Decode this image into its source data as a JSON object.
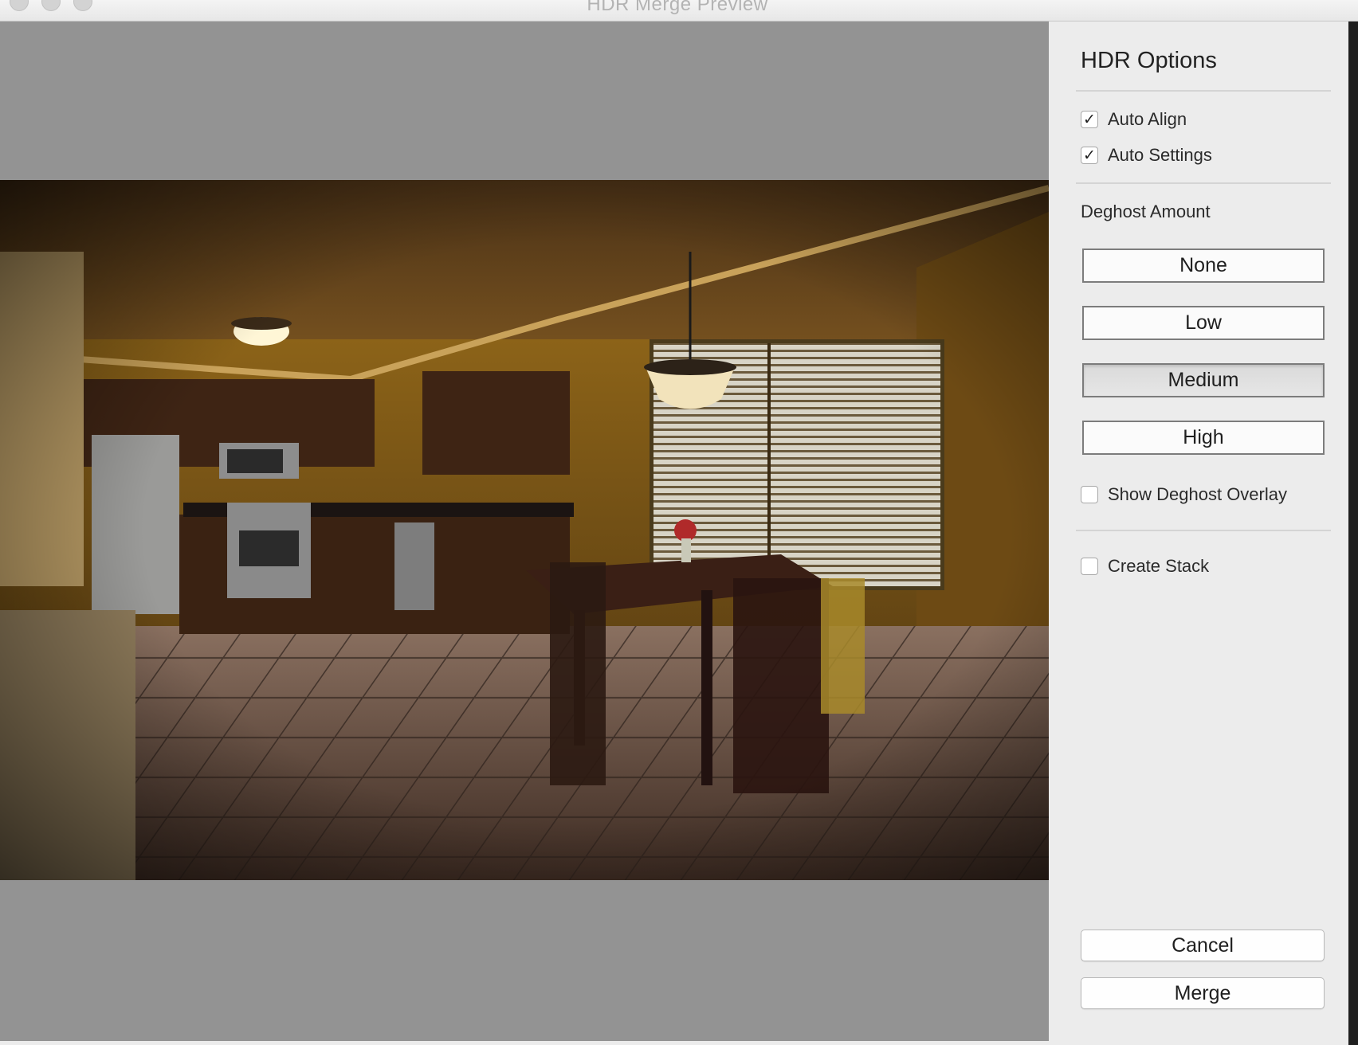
{
  "window": {
    "title": "HDR Merge Preview"
  },
  "preview": {
    "image_description": "HDR merged photo of a kitchen and dining area"
  },
  "panel": {
    "title": "HDR Options",
    "auto_align": {
      "label": "Auto Align",
      "checked": true
    },
    "auto_settings": {
      "label": "Auto Settings",
      "checked": true
    },
    "deghost": {
      "label": "Deghost Amount",
      "options": [
        "None",
        "Low",
        "Medium",
        "High"
      ],
      "selected": "Medium"
    },
    "show_overlay": {
      "label": "Show Deghost Overlay",
      "checked": false
    },
    "create_stack": {
      "label": "Create Stack",
      "checked": false
    },
    "cancel_label": "Cancel",
    "merge_label": "Merge"
  },
  "colors": {
    "panel_bg": "#ececec",
    "preview_bg": "#939393",
    "selected_button": "#dadada"
  }
}
